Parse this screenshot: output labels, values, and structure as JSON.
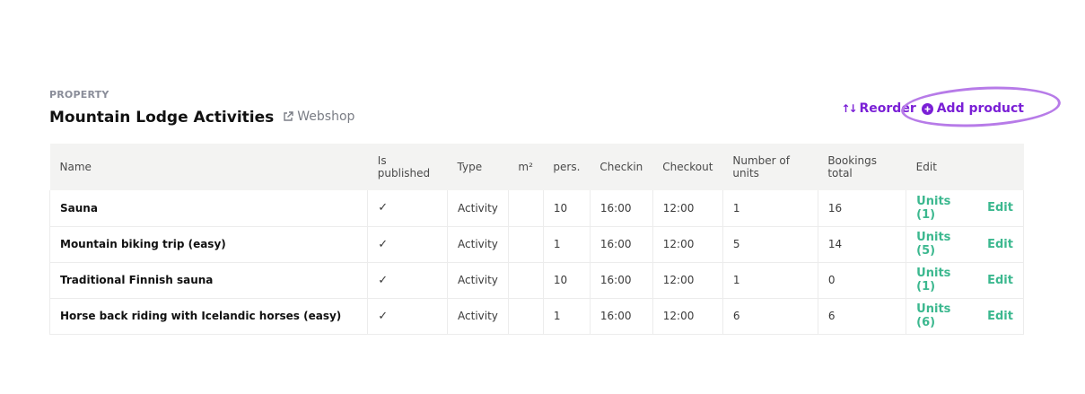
{
  "header": {
    "eyebrow": "PROPERTY",
    "title": "Mountain Lodge Activities",
    "webshop_label": "Webshop"
  },
  "actions": {
    "reorder_label": "Reorder",
    "add_product_label": "Add product",
    "accent_color": "#7a1fd6"
  },
  "table": {
    "columns": [
      "Name",
      "Is published",
      "Type",
      "m²",
      "pers.",
      "Checkin",
      "Checkout",
      "Number of units",
      "Bookings total",
      "Edit"
    ],
    "rows": [
      {
        "name": "Sauna",
        "published": "✓",
        "type": "Activity",
        "m2": "",
        "pers": "10",
        "checkin": "16:00",
        "checkout": "12:00",
        "units": "1",
        "bookings": "16",
        "units_link": "Units (1)",
        "edit_link": "Edit"
      },
      {
        "name": "Mountain biking trip (easy)",
        "published": "✓",
        "type": "Activity",
        "m2": "",
        "pers": "1",
        "checkin": "16:00",
        "checkout": "12:00",
        "units": "5",
        "bookings": "14",
        "units_link": "Units (5)",
        "edit_link": "Edit"
      },
      {
        "name": "Traditional Finnish sauna",
        "published": "✓",
        "type": "Activity",
        "m2": "",
        "pers": "10",
        "checkin": "16:00",
        "checkout": "12:00",
        "units": "1",
        "bookings": "0",
        "units_link": "Units (1)",
        "edit_link": "Edit"
      },
      {
        "name": "Horse back riding with Icelandic horses (easy)",
        "published": "✓",
        "type": "Activity",
        "m2": "",
        "pers": "1",
        "checkin": "16:00",
        "checkout": "12:00",
        "units": "6",
        "bookings": "6",
        "units_link": "Units (6)",
        "edit_link": "Edit"
      }
    ],
    "link_color": "#3cb88f"
  }
}
